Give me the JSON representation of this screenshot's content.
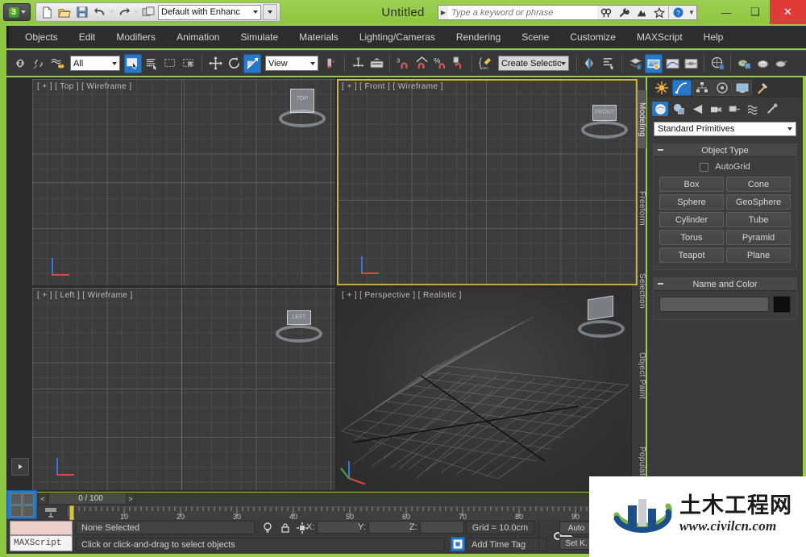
{
  "app": {
    "title": "Untitled",
    "logo_icon": "3dsmax-logo-icon"
  },
  "titlebar": {
    "quick_access": [
      {
        "name": "new-file-icon",
        "label": "New"
      },
      {
        "name": "open-file-icon",
        "label": "Open"
      },
      {
        "name": "save-file-icon",
        "label": "Save"
      },
      {
        "name": "undo-icon",
        "label": "Undo"
      },
      {
        "name": "redo-icon",
        "label": "Redo"
      },
      {
        "name": "set-project-folder-icon",
        "label": "Set Project Folder"
      }
    ],
    "workspace": "Default with Enhanc",
    "search_placeholder": "Type a keyword or phrase",
    "help_icons": [
      "search-group-icon",
      "wrench-icon",
      "subscription-icon",
      "favorites-star-icon",
      "help-question-icon"
    ],
    "window_buttons": {
      "minimize": "—",
      "maximize": "❑",
      "close": "✕"
    }
  },
  "menubar": {
    "items": [
      "Objects",
      "Edit",
      "Modifiers",
      "Animation",
      "Simulate",
      "Materials",
      "Lighting/Cameras",
      "Rendering",
      "Scene",
      "Customize",
      "MAXScript",
      "Help"
    ]
  },
  "toolbar": {
    "selection_filter": "All",
    "reference_coordinate": "View",
    "named_selection_sets": "Create Selection Se",
    "snap_value": "3",
    "percent": "%",
    "buttons": [
      {
        "name": "select-and-link-icon"
      },
      {
        "name": "unlink-selection-icon"
      },
      {
        "name": "bind-to-space-warp-icon"
      },
      {
        "name": "select-object-icon",
        "selected": true
      },
      {
        "name": "select-by-name-icon"
      },
      {
        "name": "rectangular-selection-region-icon"
      },
      {
        "name": "window-crossing-icon"
      },
      {
        "name": "select-and-move-icon"
      },
      {
        "name": "select-and-rotate-icon"
      },
      {
        "name": "select-and-scale-icon"
      },
      {
        "name": "use-center-flyout-icon"
      },
      {
        "name": "select-and-manipulate-icon"
      },
      {
        "name": "keyboard-shortcut-override-icon"
      },
      {
        "name": "snaps-toggle-icon"
      },
      {
        "name": "angle-snap-toggle-icon"
      },
      {
        "name": "percent-snap-toggle-icon"
      },
      {
        "name": "spinner-snap-toggle-icon"
      },
      {
        "name": "edit-named-selection-sets-icon"
      },
      {
        "name": "mirror-icon"
      },
      {
        "name": "align-icon"
      },
      {
        "name": "layer-explorer-icon"
      },
      {
        "name": "toggle-scene-explorer-icon",
        "selected": true
      },
      {
        "name": "curve-editor-icon"
      },
      {
        "name": "schematic-view-icon"
      },
      {
        "name": "material-editor-icon"
      },
      {
        "name": "render-setup-icon"
      },
      {
        "name": "rendered-frame-window-icon"
      },
      {
        "name": "render-production-icon"
      }
    ]
  },
  "ribbon_tabs": [
    {
      "label": "Modeling",
      "selected": true
    },
    {
      "label": "Freeform",
      "selected": false
    },
    {
      "label": "Selection",
      "selected": false
    },
    {
      "label": "Object Paint",
      "selected": false
    },
    {
      "label": "Populate",
      "selected": false
    }
  ],
  "viewports": [
    {
      "id": "top",
      "label": "[ + ] [ Top ] [ Wireframe ]",
      "active": false
    },
    {
      "id": "front",
      "label": "[ + ] [ Front ] [ Wireframe ]",
      "active": true
    },
    {
      "id": "left",
      "label": "[ + ] [ Left ] [ Wireframe ]",
      "active": false
    },
    {
      "id": "perspective",
      "label": "[ + ] [ Perspective ] [ Realistic ]",
      "active": false
    }
  ],
  "viewcubes": [
    {
      "viewport": "top",
      "face": "TOP"
    },
    {
      "viewport": "front",
      "face": "FRONT"
    },
    {
      "viewport": "left",
      "face": "LEFT"
    },
    {
      "viewport": "perspective",
      "face": ""
    }
  ],
  "command_panel": {
    "tabs": [
      {
        "name": "create-tab",
        "icon": "star-create-icon",
        "selected": true
      },
      {
        "name": "modify-tab",
        "icon": "modify-curve-icon",
        "selected": false
      },
      {
        "name": "hierarchy-tab",
        "icon": "hierarchy-icon",
        "selected": false
      },
      {
        "name": "motion-tab",
        "icon": "motion-wheel-icon",
        "selected": false
      },
      {
        "name": "display-tab",
        "icon": "display-monitor-icon",
        "selected": false
      },
      {
        "name": "utilities-tab",
        "icon": "utilities-hammer-icon",
        "selected": false
      }
    ],
    "create_types": [
      {
        "name": "geometry-button",
        "icon": "sphere-icon",
        "selected": true
      },
      {
        "name": "shapes-button",
        "icon": "shapes-icon",
        "selected": false
      },
      {
        "name": "lights-button",
        "icon": "light-cone-icon",
        "selected": false
      },
      {
        "name": "cameras-button",
        "icon": "camera-icon",
        "selected": false
      },
      {
        "name": "helpers-button",
        "icon": "helper-tape-icon",
        "selected": false
      },
      {
        "name": "space-warps-button",
        "icon": "space-warp-icon",
        "selected": false
      },
      {
        "name": "systems-button",
        "icon": "systems-bone-icon",
        "selected": false
      }
    ],
    "category": "Standard Primitives",
    "rollouts": [
      {
        "title": "Object Type",
        "autogrid_label": "AutoGrid",
        "autogrid_checked": false,
        "buttons": [
          "Box",
          "Cone",
          "Sphere",
          "GeoSphere",
          "Cylinder",
          "Tube",
          "Torus",
          "Pyramid",
          "Teapot",
          "Plane"
        ]
      },
      {
        "title": "Name and Color",
        "name_value": "",
        "color_hex": "#0d0d0d"
      }
    ]
  },
  "timeline": {
    "frame_display": "0 / 100",
    "prev_arrow": "<",
    "next_arrow": ">",
    "current_frame": 0,
    "range_start": 0,
    "range_end": 100,
    "tick_labels": [
      "10",
      "20",
      "30",
      "40",
      "50",
      "60",
      "70",
      "80",
      "90"
    ]
  },
  "statusbar": {
    "maxscript_label": "MAXScript",
    "selection_status": "None Selected",
    "prompt": "Click or click-and-drag to select objects",
    "coords": [
      {
        "label": "X:",
        "value": ""
      },
      {
        "label": "Y:",
        "value": ""
      },
      {
        "label": "Z:",
        "value": ""
      }
    ],
    "grid_text": "Grid = 10.0cm",
    "add_time_tag": "Add Time Tag",
    "auto_key": "Auto",
    "set_key": "Set K.",
    "icons": [
      "lightbulb-icon",
      "lock-selection-icon",
      "absolute-relative-mode-icon",
      "key-filters-icon"
    ]
  },
  "watermark": {
    "chinese": "土木工程网",
    "url": "www.civilcn.com",
    "logo_icon": "civilcn-building-logo-icon"
  },
  "colors": {
    "brand_green": "#8cc63e",
    "accent_blue": "#2878c8",
    "panel_gray": "#3a3a3a",
    "active_viewport_border": "#c8a94a"
  }
}
